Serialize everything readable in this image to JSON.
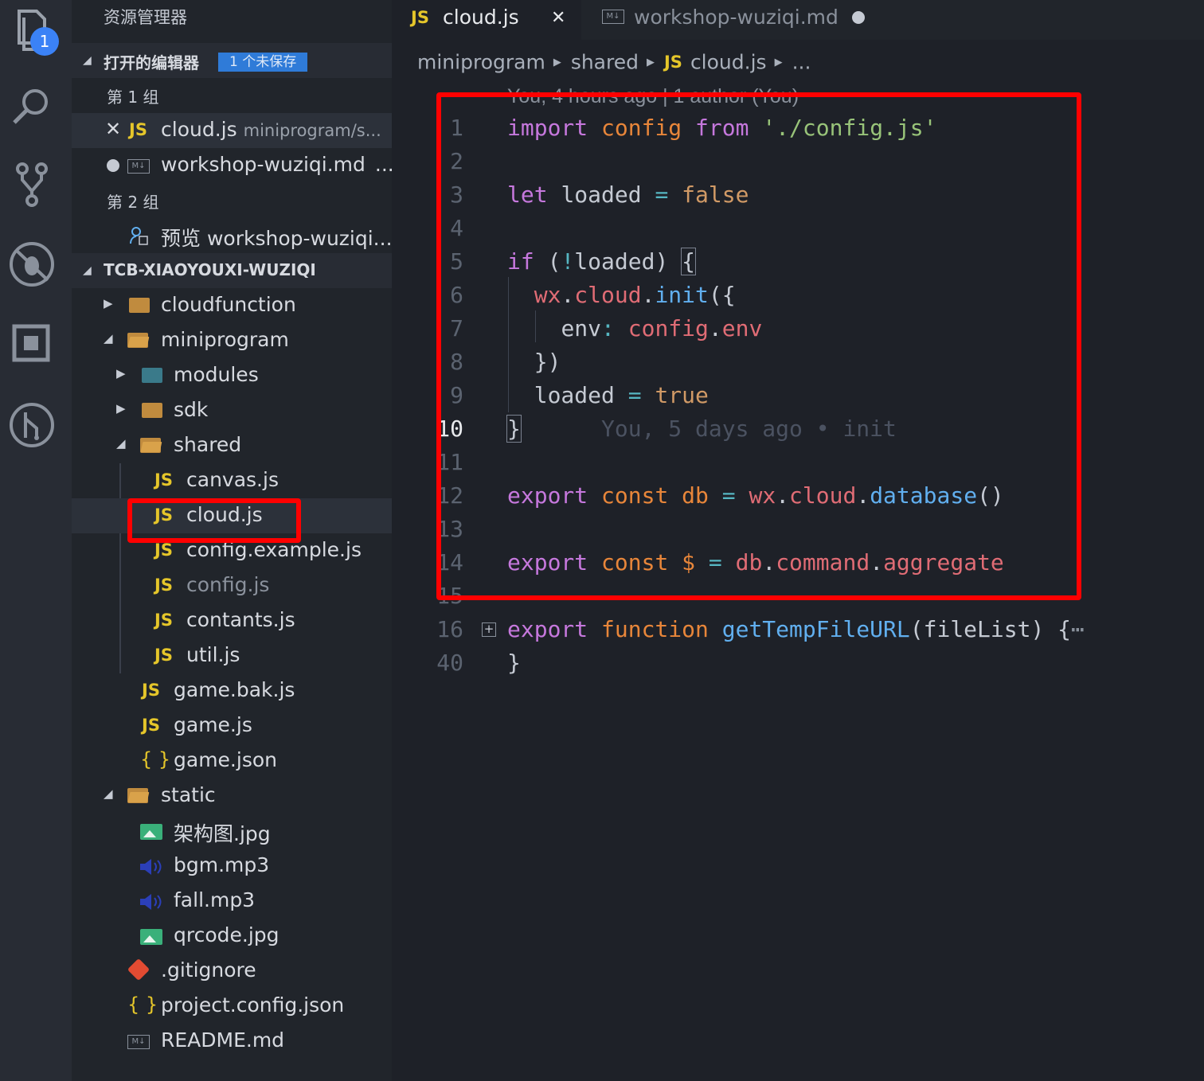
{
  "activity_bar": {
    "badge_count": "1",
    "icons": [
      "explorer-icon",
      "search-icon",
      "source-control-icon",
      "debug-icon",
      "extensions-icon",
      "git-graph-icon"
    ]
  },
  "sidebar": {
    "title": "资源管理器",
    "open_editors": {
      "label": "打开的编辑器",
      "unsaved_badge": "1 个未保存",
      "group1": "第 1 组",
      "group2": "第 2 组",
      "items": [
        {
          "name": "cloud.js",
          "path": "miniprogram/s..."
        },
        {
          "name": "workshop-wuziqi.md",
          "path": "..."
        },
        {
          "name": "预览 workshop-wuziqi..."
        }
      ]
    },
    "project": {
      "label": "TCB-XIAOYOUXI-WUZIQI",
      "tree": [
        {
          "name": "cloudfunction"
        },
        {
          "name": "miniprogram"
        },
        {
          "name": "modules"
        },
        {
          "name": "sdk"
        },
        {
          "name": "shared"
        },
        {
          "name": "canvas.js"
        },
        {
          "name": "cloud.js"
        },
        {
          "name": "config.example.js"
        },
        {
          "name": "config.js"
        },
        {
          "name": "contants.js"
        },
        {
          "name": "util.js"
        },
        {
          "name": "game.bak.js"
        },
        {
          "name": "game.js"
        },
        {
          "name": "game.json"
        },
        {
          "name": "static"
        },
        {
          "name": "架构图.jpg"
        },
        {
          "name": "bgm.mp3"
        },
        {
          "name": "fall.mp3"
        },
        {
          "name": "qrcode.jpg"
        },
        {
          "name": ".gitignore"
        },
        {
          "name": "project.config.json"
        },
        {
          "name": "README.md"
        }
      ]
    }
  },
  "tabs": [
    {
      "label": "cloud.js",
      "icon": "JS",
      "close": "✕"
    },
    {
      "label": "workshop-wuziqi.md",
      "icon": "M↓"
    }
  ],
  "breadcrumb": [
    "miniprogram",
    "shared",
    "cloud.js",
    "..."
  ],
  "breadcrumb_js": "JS",
  "code": {
    "codelens": "You, 4 hours ago | 1 author (You)",
    "blame": "You, 5 days ago • init",
    "line_numbers": [
      "1",
      "2",
      "3",
      "4",
      "5",
      "6",
      "7",
      "8",
      "9",
      "10",
      "11",
      "12",
      "13",
      "14",
      "15",
      "16",
      "40"
    ]
  }
}
